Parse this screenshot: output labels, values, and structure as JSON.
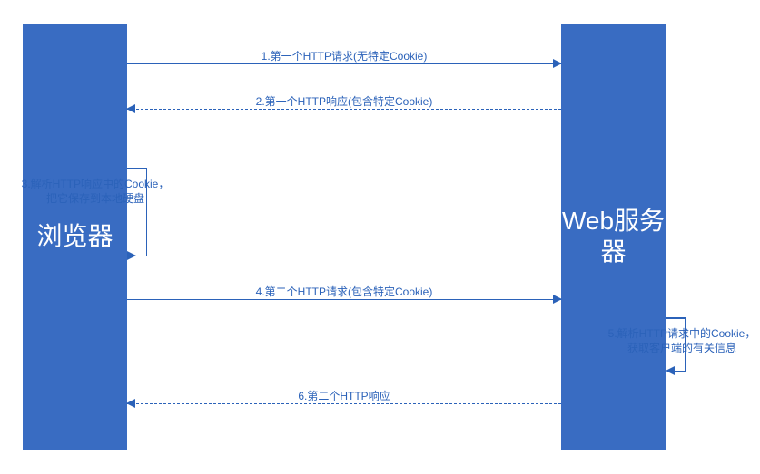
{
  "left_block_label": "浏览器",
  "right_block_label": "Web服务器",
  "messages": {
    "m1": "1.第一个HTTP请求(无特定Cookie)",
    "m2": "2.第一个HTTP响应(包含特定Cookie)",
    "m4": "4.第二个HTTP请求(包含特定Cookie)",
    "m6": "6.第二个HTTP响应"
  },
  "notes": {
    "n3_line1": "3.解析HTTP响应中的Cookie，",
    "n3_line2": "把它保存到本地硬盘",
    "n5_line1": "5.解析HTTP请求中的Cookie，",
    "n5_line2": "获取客户端的有关信息"
  },
  "colors": {
    "block_fill": "#396cc2",
    "line": "#2b62b9"
  }
}
